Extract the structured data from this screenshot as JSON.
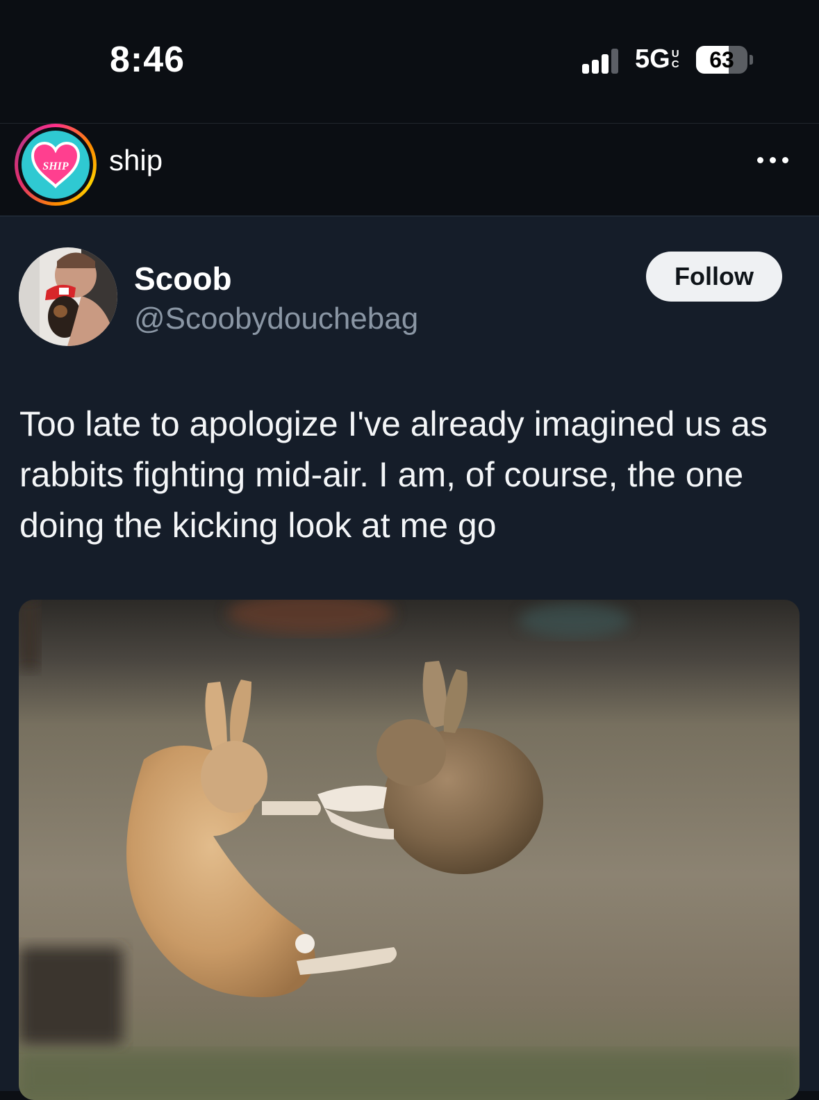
{
  "status_bar": {
    "time": "8:46",
    "network": "5G",
    "network_suffix": "UC",
    "battery": "63",
    "battery_level": 0.63
  },
  "reel": {
    "account_name": "ship",
    "avatar_logo_text": "SHIP"
  },
  "tweet": {
    "author_name": "Scoob",
    "author_handle": "@Scoobydouchebag",
    "follow_label": "Follow",
    "text": "Too late to apologize I've already imagined us as rabbits fighting mid-air. I am, of course, the one doing the kicking look at me go"
  },
  "colors": {
    "background": "#0b0e13",
    "card": "#151d29",
    "handle": "#8a96a4",
    "follow_bg": "#eff1f3",
    "logo_teal": "#2fc9d2",
    "logo_heart": "#ff3f8f"
  },
  "icons": [
    "signal-bars-icon",
    "battery-icon",
    "more-options-icon",
    "ship-heart-logo"
  ]
}
